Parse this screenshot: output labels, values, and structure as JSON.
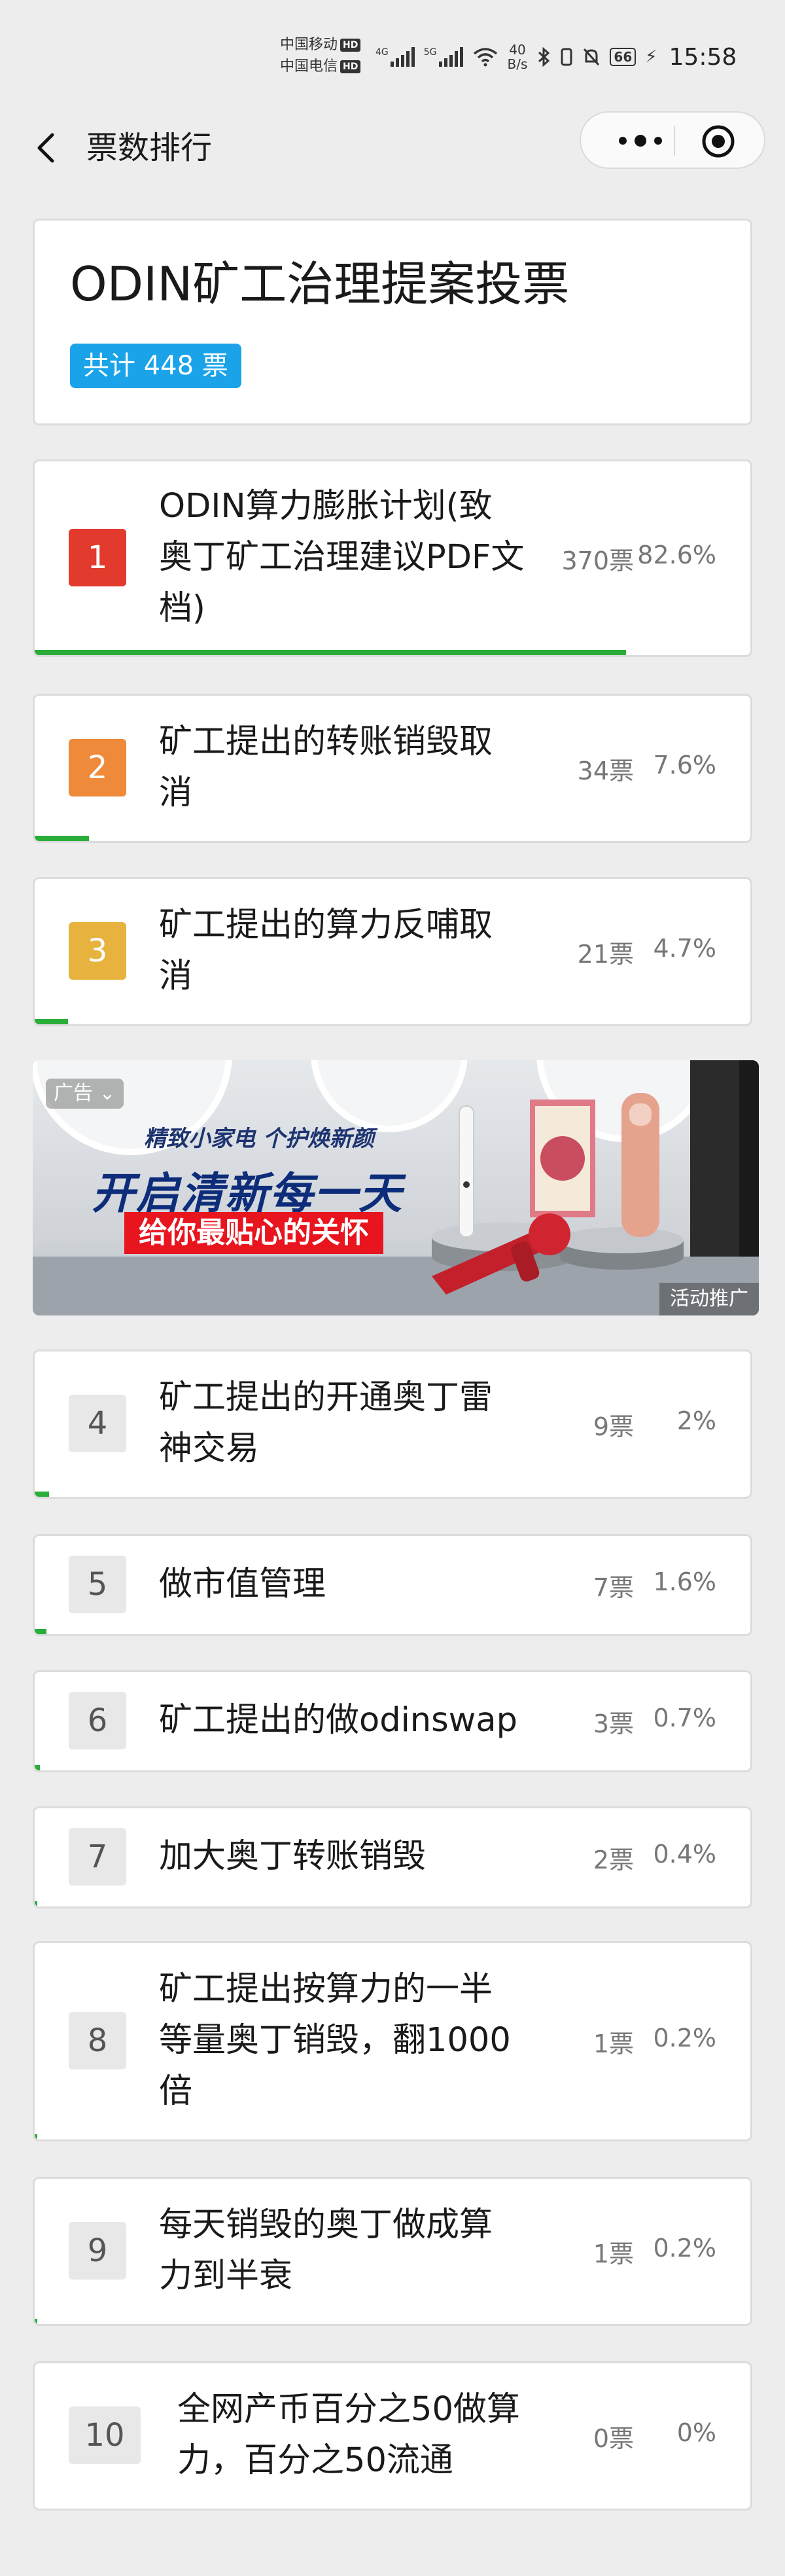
{
  "status_bar": {
    "carrier_1": "中国移动",
    "carrier_2": "中国电信",
    "hd": "HD",
    "net_4g": "4G",
    "net_5g": "5G",
    "net_speed_value": "40",
    "net_speed_unit": "B/s",
    "battery": "66",
    "time": "15:58"
  },
  "nav": {
    "title": "票数排行"
  },
  "header": {
    "title": "ODIN矿工治理提案投票",
    "total": "共计 448 票"
  },
  "items": [
    {
      "rank": "1",
      "title": "ODIN算力膨胀计划(致奥丁矿工治理建议PDF文档)",
      "votes": "370票",
      "percent": "82.6%",
      "share": 0.826
    },
    {
      "rank": "2",
      "title": "矿工提出的转账销毁取消",
      "votes": "34票",
      "percent": "7.6%",
      "share": 0.076
    },
    {
      "rank": "3",
      "title": "矿工提出的算力反哺取消",
      "votes": "21票",
      "percent": "4.7%",
      "share": 0.047
    },
    {
      "rank": "4",
      "title": "矿工提出的开通奥丁雷神交易",
      "votes": "9票",
      "percent": "2%",
      "share": 0.02
    },
    {
      "rank": "5",
      "title": "做市值管理",
      "votes": "7票",
      "percent": "1.6%",
      "share": 0.016
    },
    {
      "rank": "6",
      "title": "矿工提出的做odinswap",
      "votes": "3票",
      "percent": "0.7%",
      "share": 0.007
    },
    {
      "rank": "7",
      "title": "加大奥丁转账销毁",
      "votes": "2票",
      "percent": "0.4%",
      "share": 0.004
    },
    {
      "rank": "8",
      "title": "矿工提出按算力的一半等量奥丁销毁，翻1000倍",
      "votes": "1票",
      "percent": "0.2%",
      "share": 0.002
    },
    {
      "rank": "9",
      "title": "每天销毁的奥丁做成算力到半衰",
      "votes": "1票",
      "percent": "0.2%",
      "share": 0.002
    },
    {
      "rank": "10",
      "title": "全网产币百分之50做算力，百分之50流通",
      "votes": "0票",
      "percent": "0%",
      "share": 0
    }
  ],
  "rank_colors": {
    "1": "#e23b2e",
    "2": "#ef8a3a",
    "3": "#e8b23f"
  },
  "ad": {
    "tag": "广告",
    "sub": "精致小家电  个护焕新颜",
    "headline": "开启清新每一天",
    "pill": "给你最贴心的关怀",
    "footer": "活动推广"
  }
}
